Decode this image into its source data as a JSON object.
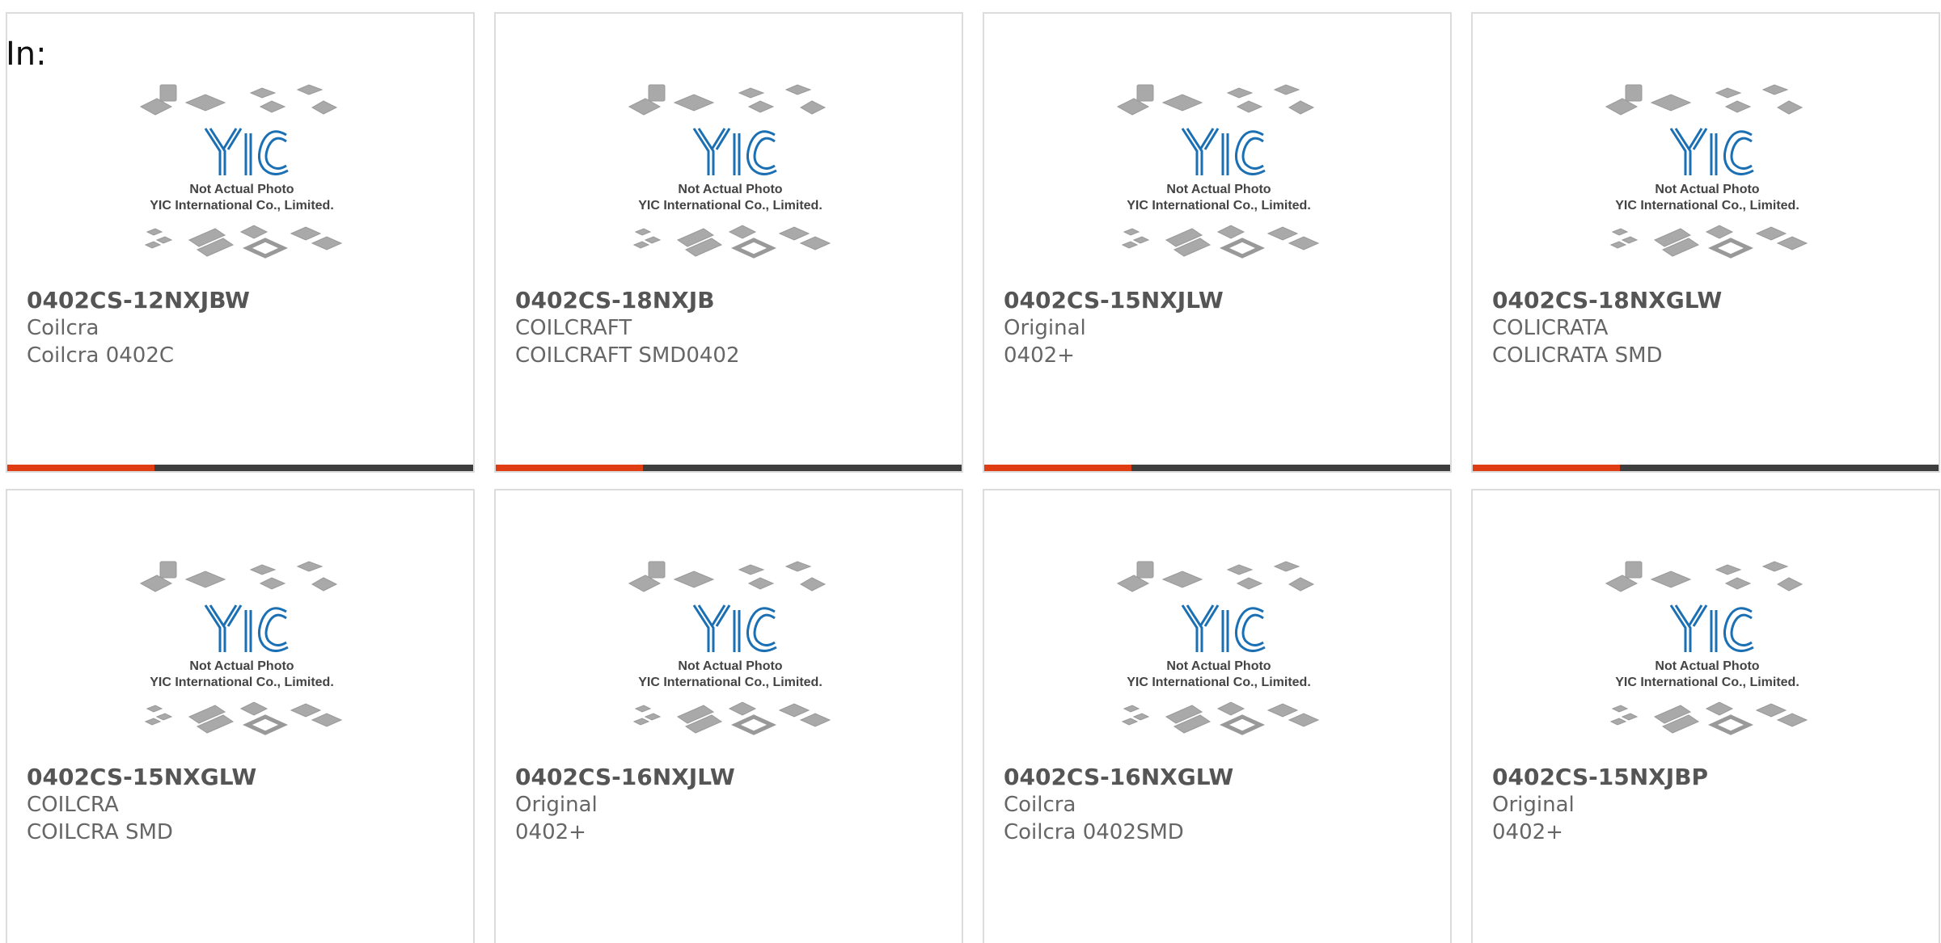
{
  "filter_label": "In:",
  "placeholder_image": {
    "logo_text": "YIC",
    "line1": "Not Actual Photo",
    "line2": "YIC International Co., Limited."
  },
  "colors": {
    "accent": "#e03e12",
    "bar_dark": "#3d3d3d",
    "logo_blue": "#1b6fb3"
  },
  "products": [
    {
      "part": "0402CS-12NXJBW",
      "brand": "Coilcra",
      "package": "Coilcra 0402C"
    },
    {
      "part": "0402CS-18NXJB",
      "brand": "COILCRAFT",
      "package": "COILCRAFT SMD0402"
    },
    {
      "part": "0402CS-15NXJLW",
      "brand": "Original",
      "package": "0402+"
    },
    {
      "part": "0402CS-18NXGLW",
      "brand": "COLICRATA",
      "package": "COLICRATA SMD"
    },
    {
      "part": "0402CS-15NXGLW",
      "brand": "COILCRA",
      "package": "COILCRA SMD"
    },
    {
      "part": "0402CS-16NXJLW",
      "brand": "Original",
      "package": "0402+"
    },
    {
      "part": "0402CS-16NXGLW",
      "brand": "Coilcra",
      "package": "Coilcra 0402SMD"
    },
    {
      "part": "0402CS-15NXJBP",
      "brand": "Original",
      "package": "0402+"
    }
  ]
}
